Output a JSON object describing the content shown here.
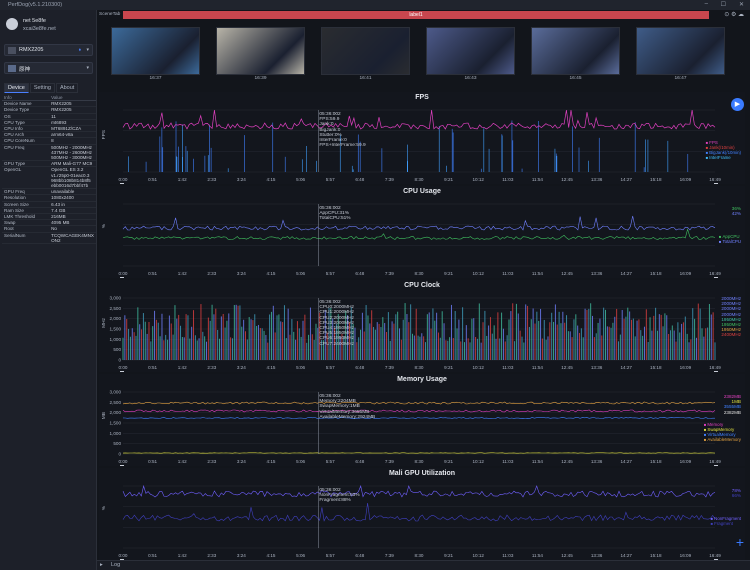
{
  "window": {
    "title": "PerfDog(v5.1.210300)"
  },
  "user": {
    "name": "net 5e8fe",
    "email": "xcai3e8fe.net"
  },
  "device_select": {
    "label": "RMX2205"
  },
  "app_select": {
    "label": "原神"
  },
  "tabs": [
    "Device",
    "Setting",
    "About"
  ],
  "info": {
    "headers": [
      "Info",
      "Value"
    ],
    "rows": [
      [
        "Device Name",
        "RMX2205"
      ],
      [
        "Device Type",
        "RMX2205"
      ],
      [
        "OS",
        "11"
      ],
      [
        "CPU Type",
        "mt6893"
      ],
      [
        "CPU Info",
        "MT6891Z/CZA"
      ],
      [
        "CPU Arch",
        "arm64-v8a"
      ],
      [
        "CPU CoreNum",
        "8"
      ],
      [
        "CPU Freq",
        "500MHz - 2000MHz\n437MHz - 2600MHz\n500MHz - 3000MHz"
      ],
      [
        "GPU Type",
        "ARM Mali-G77 MC9"
      ],
      [
        "OpenGL",
        "OpenGL ES 3.2\nv1.r25p0-01eac0.3\n968bb108b814b8f5\nebb0016d7bbf47b"
      ],
      [
        "GPU Freq",
        "unavailable"
      ],
      [
        "Resolution",
        "1080x2400"
      ],
      [
        "Screen Size",
        "6.43 in"
      ],
      [
        "Ram Size",
        "7.4 GB"
      ],
      [
        "LMK Threshold",
        "216MB"
      ],
      [
        "Swap",
        "4095 MB"
      ],
      [
        "Root",
        "No"
      ],
      [
        "SerialNum",
        "TCQWCAGEK4MNX\nON2"
      ]
    ]
  },
  "main": {
    "scene_tab": "SceneTab",
    "active_tab": "label1"
  },
  "thumbs": [
    {
      "time": "16:37",
      "color": "#3c6a9a"
    },
    {
      "time": "16:39",
      "color": "#b8b4a8"
    },
    {
      "time": "16:41",
      "color": "#2a2c30"
    },
    {
      "time": "16:43",
      "color": "#4d5a8a"
    },
    {
      "time": "16:45",
      "color": "#5a6c9a"
    },
    {
      "time": "16:47",
      "color": "#3f5c88"
    }
  ],
  "x_ticks": [
    "0:00",
    "0:51",
    "1:42",
    "2:33",
    "3:24",
    "4:15",
    "5:06",
    "5:57",
    "6:48",
    "7:39",
    "8:30",
    "9:21",
    "10:12",
    "11:03",
    "11:54",
    "12:45",
    "13:36",
    "14:27",
    "15:18",
    "16:09",
    "16:49"
  ],
  "panes": [
    {
      "title": "FPS",
      "ylabel": "FPS",
      "yticks": [
        "",
        "",
        "",
        ""
      ],
      "tooltip": [
        "05:36:002",
        "FPS:59.9",
        "Jank:0",
        "BigJank:0",
        "Stutter:0%",
        "InterFrame:0",
        "FPS+InterFrame:59.9"
      ],
      "legend": [
        {
          "name": "FPS",
          "color": "#e040c0"
        },
        {
          "name": "Jank(/10min)",
          "color": "#e04040"
        },
        {
          "name": "BigJank(/10min)",
          "color": "#4080ff"
        },
        {
          "name": "InterFrame",
          "color": "#40c0ff"
        }
      ],
      "sidevals": []
    },
    {
      "title": "CPU Usage",
      "ylabel": "%",
      "yticks": [
        "",
        "",
        "",
        ""
      ],
      "tooltip": [
        "05:36:002",
        "AppCPU:31%",
        "TotalCPU:51%"
      ],
      "legend": [
        {
          "name": "AppCPU",
          "color": "#40c060"
        },
        {
          "name": "TotalCPU",
          "color": "#7080ff"
        }
      ],
      "sidevals": [
        {
          "text": "36%",
          "color": "#40c060"
        },
        {
          "text": "42%",
          "color": "#7080ff"
        }
      ]
    },
    {
      "title": "CPU Clock",
      "ylabel": "MHz",
      "yticks": [
        "3,000",
        "2,500",
        "2,000",
        "1,500",
        "1,000",
        "500",
        "0"
      ],
      "tooltip": [
        "05:36:002",
        "CPU0:2000MHz",
        "CPU1:2000MHz",
        "CPU2:2000MHz",
        "CPU3:2000MHz",
        "CPU4:1950MHz",
        "CPU5:1950MHz",
        "CPU6:1950MHz",
        "CPU7:2400MHz"
      ],
      "legend": [],
      "sidevals": [
        {
          "text": "2000MHz",
          "color": "#7080ff"
        },
        {
          "text": "2000MHz",
          "color": "#7080ff"
        },
        {
          "text": "2000MHz",
          "color": "#7080ff"
        },
        {
          "text": "2000MHz",
          "color": "#7080ff"
        },
        {
          "text": "1950MHz",
          "color": "#40c0a0"
        },
        {
          "text": "1950MHz",
          "color": "#40c060"
        },
        {
          "text": "1950MHz",
          "color": "#e0a040"
        },
        {
          "text": "2400MHz",
          "color": "#e04040"
        }
      ]
    },
    {
      "title": "Memory Usage",
      "ylabel": "MB",
      "yticks": [
        "3,000",
        "2,500",
        "2,000",
        "1,500",
        "1,000",
        "500",
        "0"
      ],
      "tooltip": [
        "05:36:002",
        "Memory:2204MB",
        "SwapMemory:1MB",
        "VirtualMemory:3655MB",
        "AvailableMemory:2924MB"
      ],
      "legend": [
        {
          "name": "Memory",
          "color": "#e040c0"
        },
        {
          "name": "SwapMemory",
          "color": "#e0e040"
        },
        {
          "name": "VirtualMemory",
          "color": "#4080ff"
        },
        {
          "name": "AvailableMemory",
          "color": "#e0a040"
        }
      ],
      "sidevals": [
        {
          "text": "2382MB",
          "color": "#e040c0"
        },
        {
          "text": "1MB",
          "color": "#e0e040"
        },
        {
          "text": "3555MB",
          "color": "#4080ff"
        },
        {
          "text": "2382MB",
          "color": "#e0e0e0"
        }
      ]
    },
    {
      "title": "Mali GPU Utilization",
      "ylabel": "%",
      "yticks": [
        "",
        "",
        "",
        ""
      ],
      "tooltip": [
        "05:36:002",
        "NonFragment:83%",
        "Fragment:88%"
      ],
      "legend": [
        {
          "name": "NonFragment",
          "color": "#7060ff"
        },
        {
          "name": "Fragment",
          "color": "#4040c0"
        }
      ],
      "sidevals": [
        {
          "text": "78%",
          "color": "#7060ff"
        },
        {
          "text": "66%",
          "color": "#4040c0"
        }
      ]
    }
  ],
  "log": {
    "label": "Log"
  }
}
